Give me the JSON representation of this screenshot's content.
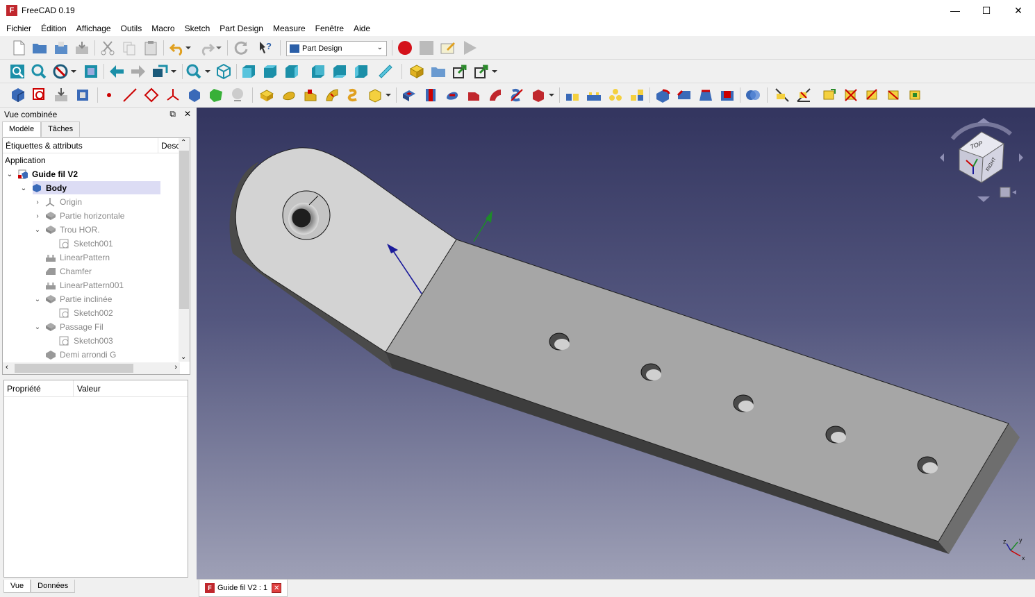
{
  "window": {
    "title": "FreeCAD 0.19",
    "app_icon": "freecad-logo",
    "minimize": "—",
    "maximize": "☐",
    "close": "✕"
  },
  "menu": [
    "Fichier",
    "Édition",
    "Affichage",
    "Outils",
    "Macro",
    "Sketch",
    "Part Design",
    "Measure",
    "Fenêtre",
    "Aide"
  ],
  "workbench": {
    "selected": "Part Design"
  },
  "combo_view": {
    "title": "Vue combinée",
    "tabs": [
      "Modèle",
      "Tâches"
    ],
    "tree_header": {
      "labels": "Étiquettes & attributs",
      "desc": "Desc"
    },
    "tree": [
      {
        "label": "Application",
        "level": 0,
        "expander": "",
        "icon": "none",
        "style": "normal"
      },
      {
        "label": "Guide fil V2",
        "level": 0,
        "expander": "v",
        "icon": "document-icon",
        "style": "bold"
      },
      {
        "label": "Body",
        "level": 1,
        "expander": "v",
        "icon": "body-icon",
        "style": "bold"
      },
      {
        "label": "Origin",
        "level": 2,
        "expander": ">",
        "icon": "origin-icon",
        "style": "dim"
      },
      {
        "label": "Partie horizontale",
        "level": 2,
        "expander": ">",
        "icon": "pad-icon",
        "style": "dim"
      },
      {
        "label": "Trou HOR.",
        "level": 2,
        "expander": "v",
        "icon": "pocket-icon",
        "style": "dim"
      },
      {
        "label": "Sketch001",
        "level": 3,
        "expander": "",
        "icon": "sketch-icon",
        "style": "dim"
      },
      {
        "label": "LinearPattern",
        "level": 2,
        "expander": "",
        "icon": "linear-pattern-icon",
        "style": "dim"
      },
      {
        "label": "Chamfer",
        "level": 2,
        "expander": "",
        "icon": "chamfer-icon",
        "style": "dim"
      },
      {
        "label": "LinearPattern001",
        "level": 2,
        "expander": "",
        "icon": "linear-pattern-icon",
        "style": "dim"
      },
      {
        "label": "Partie inclinée",
        "level": 2,
        "expander": "v",
        "icon": "pad-icon",
        "style": "dim"
      },
      {
        "label": "Sketch002",
        "level": 3,
        "expander": "",
        "icon": "sketch-icon",
        "style": "dim"
      },
      {
        "label": "Passage Fil",
        "level": 2,
        "expander": "v",
        "icon": "pocket-icon",
        "style": "dim"
      },
      {
        "label": "Sketch003",
        "level": 3,
        "expander": "",
        "icon": "sketch-icon",
        "style": "dim"
      },
      {
        "label": "Demi arrondi G",
        "level": 2,
        "expander": "",
        "icon": "fillet-icon",
        "style": "dim"
      }
    ],
    "property_header": {
      "property": "Propriété",
      "value": "Valeur"
    },
    "bottom_tabs": [
      "Vue",
      "Données"
    ]
  },
  "navcube": {
    "top": "TOP",
    "right": "RIGHT"
  },
  "document_tab": {
    "label": "Guide fil V2 : 1"
  },
  "colors": {
    "viewport_top": "#33355f",
    "viewport_bottom": "#9ea0b6",
    "part_face": "#a8a8a8",
    "part_top_light": "#d2d2d2",
    "part_edge": "#3c3c3c"
  }
}
